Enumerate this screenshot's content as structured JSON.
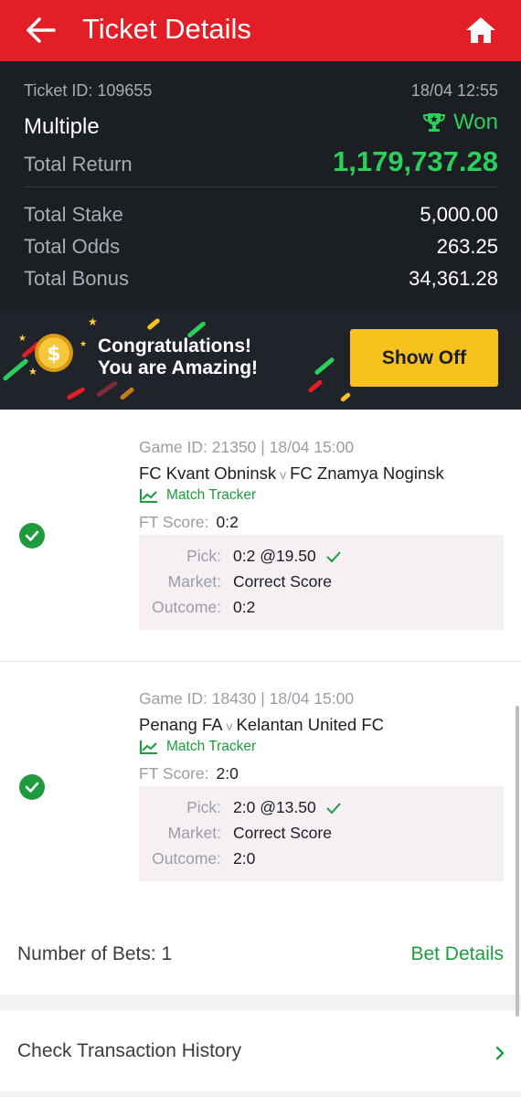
{
  "header": {
    "title": "Ticket Details",
    "back_icon": "back-arrow-icon",
    "home_icon": "home-icon"
  },
  "summary": {
    "ticket_id": "Ticket ID: 109655",
    "datetime": "18/04 12:55",
    "bet_type": "Multiple",
    "status": "Won",
    "total_return_label": "Total Return",
    "total_return": "1,179,737.28",
    "total_stake_label": "Total Stake",
    "total_stake": "5,000.00",
    "total_odds_label": "Total Odds",
    "total_odds": "263.25",
    "total_bonus_label": "Total Bonus",
    "total_bonus": "34,361.28"
  },
  "banner": {
    "line1": "Congratulations!",
    "line2": "You are Amazing!",
    "button": "Show Off"
  },
  "bets": [
    {
      "game": "Game ID: 21350 | 18/04 15:00",
      "home": "FC Kvant Obninsk",
      "vs": "v",
      "away": "FC Znamya Noginsk",
      "tracker": "Match Tracker",
      "ft_label": "FT Score:",
      "ft_score": "0:2",
      "pick_label": "Pick:",
      "pick": "0:2 @19.50",
      "market_label": "Market:",
      "market": "Correct Score",
      "outcome_label": "Outcome:",
      "outcome": "0:2"
    },
    {
      "game": "Game ID: 18430 | 18/04 15:00",
      "home": "Penang FA",
      "vs": "v",
      "away": "Kelantan United FC",
      "tracker": "Match Tracker",
      "ft_label": "FT Score:",
      "ft_score": "2:0",
      "pick_label": "Pick:",
      "pick": "2:0 @13.50",
      "market_label": "Market:",
      "market": "Correct Score",
      "outcome_label": "Outcome:",
      "outcome": "2:0"
    }
  ],
  "footer": {
    "number_of_bets": "Number of Bets: 1",
    "bet_details": "Bet Details",
    "transaction_history": "Check Transaction History"
  },
  "colors": {
    "header_red": "#e41e26",
    "won_green": "#2ccf5c",
    "link_green": "#1d9b3d",
    "show_off_yellow": "#f8c21e"
  }
}
